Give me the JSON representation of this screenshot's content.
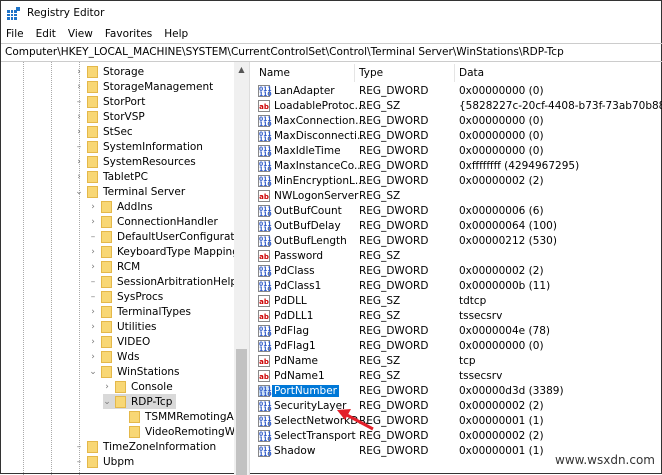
{
  "window": {
    "title": "Registry Editor"
  },
  "menu": [
    "File",
    "Edit",
    "View",
    "Favorites",
    "Help"
  ],
  "address": "Computer\\HKEY_LOCAL_MACHINE\\SYSTEM\\CurrentControlSet\\Control\\Terminal Server\\WinStations\\RDP-Tcp",
  "tree": [
    {
      "label": "Storage",
      "level": 1,
      "exp": ">"
    },
    {
      "label": "StorageManagement",
      "level": 1,
      "exp": ">"
    },
    {
      "label": "StorPort",
      "level": 1,
      "exp": ""
    },
    {
      "label": "StorVSP",
      "level": 1,
      "exp": ">"
    },
    {
      "label": "StSec",
      "level": 1,
      "exp": ">"
    },
    {
      "label": "SystemInformation",
      "level": 1,
      "exp": ""
    },
    {
      "label": "SystemResources",
      "level": 1,
      "exp": ">"
    },
    {
      "label": "TabletPC",
      "level": 1,
      "exp": ">"
    },
    {
      "label": "Terminal Server",
      "level": 1,
      "exp": "v"
    },
    {
      "label": "AddIns",
      "level": 2,
      "exp": ">"
    },
    {
      "label": "ConnectionHandler",
      "level": 2,
      "exp": ">"
    },
    {
      "label": "DefaultUserConfiguration",
      "level": 2,
      "exp": ""
    },
    {
      "label": "KeyboardType Mapping",
      "level": 2,
      "exp": ">"
    },
    {
      "label": "RCM",
      "level": 2,
      "exp": ">"
    },
    {
      "label": "SessionArbitrationHelper",
      "level": 2,
      "exp": ""
    },
    {
      "label": "SysProcs",
      "level": 2,
      "exp": ""
    },
    {
      "label": "TerminalTypes",
      "level": 2,
      "exp": ">"
    },
    {
      "label": "Utilities",
      "level": 2,
      "exp": ">"
    },
    {
      "label": "VIDEO",
      "level": 2,
      "exp": ">"
    },
    {
      "label": "Wds",
      "level": 2,
      "exp": ">"
    },
    {
      "label": "WinStations",
      "level": 2,
      "exp": "v"
    },
    {
      "label": "Console",
      "level": 3,
      "exp": ">"
    },
    {
      "label": "RDP-Tcp",
      "level": 3,
      "exp": "v",
      "selected": true
    },
    {
      "label": "TSMMRemotingAllo",
      "level": 4,
      "exp": ""
    },
    {
      "label": "VideoRemotingWinc",
      "level": 4,
      "exp": ""
    },
    {
      "label": "TimeZoneInformation",
      "level": 1,
      "exp": ""
    },
    {
      "label": "Ubpm",
      "level": 1,
      "exp": ""
    }
  ],
  "columns": {
    "name": "Name",
    "type": "Type",
    "data": "Data"
  },
  "values": [
    {
      "name": "LanAdapter",
      "type": "REG_DWORD",
      "data": "0x00000000 (0)",
      "icon": "dword"
    },
    {
      "name": "LoadableProtoc...",
      "type": "REG_SZ",
      "data": "{5828227c-20cf-4408-b73f-73ab70b8849f}",
      "icon": "string"
    },
    {
      "name": "MaxConnection...",
      "type": "REG_DWORD",
      "data": "0x00000000 (0)",
      "icon": "dword"
    },
    {
      "name": "MaxDisconnecti...",
      "type": "REG_DWORD",
      "data": "0x00000000 (0)",
      "icon": "dword"
    },
    {
      "name": "MaxIdleTime",
      "type": "REG_DWORD",
      "data": "0x00000000 (0)",
      "icon": "dword"
    },
    {
      "name": "MaxInstanceCo...",
      "type": "REG_DWORD",
      "data": "0xffffffff (4294967295)",
      "icon": "dword"
    },
    {
      "name": "MinEncryptionL...",
      "type": "REG_DWORD",
      "data": "0x00000002 (2)",
      "icon": "dword"
    },
    {
      "name": "NWLogonServer",
      "type": "REG_SZ",
      "data": "",
      "icon": "string"
    },
    {
      "name": "OutBufCount",
      "type": "REG_DWORD",
      "data": "0x00000006 (6)",
      "icon": "dword"
    },
    {
      "name": "OutBufDelay",
      "type": "REG_DWORD",
      "data": "0x00000064 (100)",
      "icon": "dword"
    },
    {
      "name": "OutBufLength",
      "type": "REG_DWORD",
      "data": "0x00000212 (530)",
      "icon": "dword"
    },
    {
      "name": "Password",
      "type": "REG_SZ",
      "data": "",
      "icon": "string"
    },
    {
      "name": "PdClass",
      "type": "REG_DWORD",
      "data": "0x00000002 (2)",
      "icon": "dword"
    },
    {
      "name": "PdClass1",
      "type": "REG_DWORD",
      "data": "0x0000000b (11)",
      "icon": "dword"
    },
    {
      "name": "PdDLL",
      "type": "REG_SZ",
      "data": "tdtcp",
      "icon": "string"
    },
    {
      "name": "PdDLL1",
      "type": "REG_SZ",
      "data": "tssecsrv",
      "icon": "string"
    },
    {
      "name": "PdFlag",
      "type": "REG_DWORD",
      "data": "0x0000004e (78)",
      "icon": "dword"
    },
    {
      "name": "PdFlag1",
      "type": "REG_DWORD",
      "data": "0x00000000 (0)",
      "icon": "dword"
    },
    {
      "name": "PdName",
      "type": "REG_SZ",
      "data": "tcp",
      "icon": "string"
    },
    {
      "name": "PdName1",
      "type": "REG_SZ",
      "data": "tssecsrv",
      "icon": "string"
    },
    {
      "name": "PortNumber",
      "type": "REG_DWORD",
      "data": "0x00000d3d (3389)",
      "icon": "dword",
      "selected": true
    },
    {
      "name": "SecurityLayer",
      "type": "REG_DWORD",
      "data": "0x00000002 (2)",
      "icon": "dword"
    },
    {
      "name": "SelectNetworkD...",
      "type": "REG_DWORD",
      "data": "0x00000001 (1)",
      "icon": "dword"
    },
    {
      "name": "SelectTransport",
      "type": "REG_DWORD",
      "data": "0x00000002 (2)",
      "icon": "dword"
    },
    {
      "name": "Shadow",
      "type": "REG_DWORD",
      "data": "0x00000001 (1)",
      "icon": "dword"
    }
  ],
  "colors": {
    "selection": "#0078d7",
    "arrow": "#e3202a",
    "folder": "#f8d775"
  },
  "watermark": "www.wsxdn.com"
}
